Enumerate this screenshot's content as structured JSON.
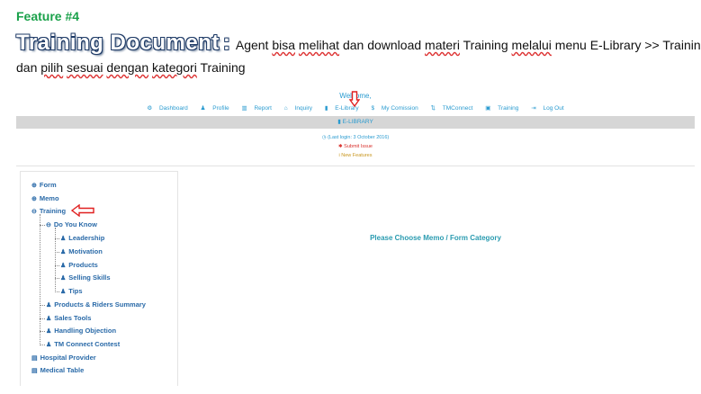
{
  "doc": {
    "feature": "Feature #4",
    "title": "Training Document",
    "colon": ":",
    "desc_parts": [
      "Agent ",
      "bisa",
      " ",
      "melihat",
      " dan download ",
      "materi",
      " Training ",
      "melalui",
      " menu E-Library >> Training"
    ],
    "line2_parts": [
      "dan ",
      "pilih",
      " ",
      "sesuai",
      " ",
      "dengan",
      " ",
      "kategori",
      " Training"
    ]
  },
  "screenshot": {
    "welcome": "Welcome,",
    "nav": [
      "Dashboard",
      "Profile",
      "Report",
      "Inquiry",
      "E-Library",
      "My Comission",
      "TMConnect",
      "Training",
      "Log Out"
    ],
    "nav_icons": [
      "gears-icon",
      "user-icon",
      "bar-chart-icon",
      "bank-icon",
      "book-icon",
      "dollar-icon",
      "exchange-icon",
      "calendar-icon",
      "sign-out-icon"
    ],
    "section_bar": "E-LIBRARY",
    "last_login": "(Last login: 3 October 2016)",
    "submit_issue": "Submit Issue",
    "new_features": "New Features",
    "placeholder": "Please Choose Memo / Form Category",
    "tree": {
      "form": "Form",
      "memo": "Memo",
      "training": "Training",
      "do_you_know": "Do You Know",
      "leadership": "Leadership",
      "motivation": "Motivation",
      "products": "Products",
      "selling_skills": "Selling Skills",
      "tips": "Tips",
      "products_riders": "Products & Riders Summary",
      "sales_tools": "Sales Tools",
      "handling_objection": "Handling Objection",
      "tm_connect_contest": "TM Connect Contest",
      "hospital_provider": "Hospital Provider",
      "medical_table": "Medical Table"
    }
  },
  "colors": {
    "accent": "#2a9bd0",
    "feature_green": "#1aa14a",
    "arrow_red": "#e02020"
  }
}
